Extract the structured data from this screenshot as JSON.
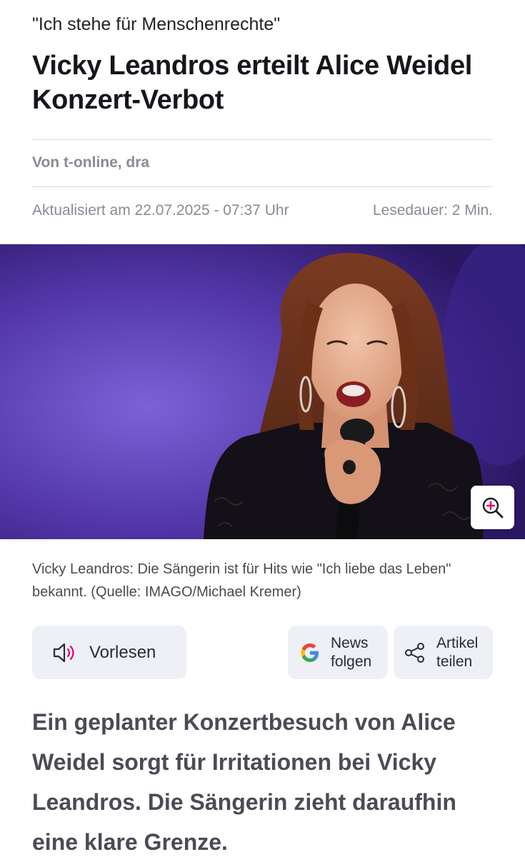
{
  "article": {
    "kicker": "\"Ich stehe für Menschenrechte\"",
    "headline": "Vicky Leandros erteilt Alice Weidel Konzert-Verbot",
    "author": "Von t-online, dra",
    "updated": "Aktualisiert am 22.07.2025 - 07:37 Uhr",
    "reading_time": "Lesedauer: 2 Min.",
    "caption": "Vicky Leandros: Die Sängerin ist für Hits wie \"Ich liebe das Leben\" bekannt. (Quelle: IMAGO/Michael Kremer)",
    "lead": "Ein geplanter Konzertbesuch von Alice Weidel sorgt für Irritationen bei Vicky Leandros. Die Sängerin zieht daraufhin eine klare Grenze."
  },
  "actions": {
    "read_aloud": {
      "label": "Vorlesen",
      "icon": "speaker-icon"
    },
    "news_follow": {
      "line1": "News",
      "line2": "folgen",
      "icon": "google-icon"
    },
    "share": {
      "line1": "Artikel",
      "line2": "teilen",
      "icon": "share-icon"
    },
    "zoom": {
      "icon": "zoom-in-icon"
    }
  },
  "colors": {
    "accent_pink": "#e20074",
    "button_bg": "#eef0f6",
    "meta_gray": "#8a8a96",
    "stage_purple": "#5a3fb0"
  }
}
